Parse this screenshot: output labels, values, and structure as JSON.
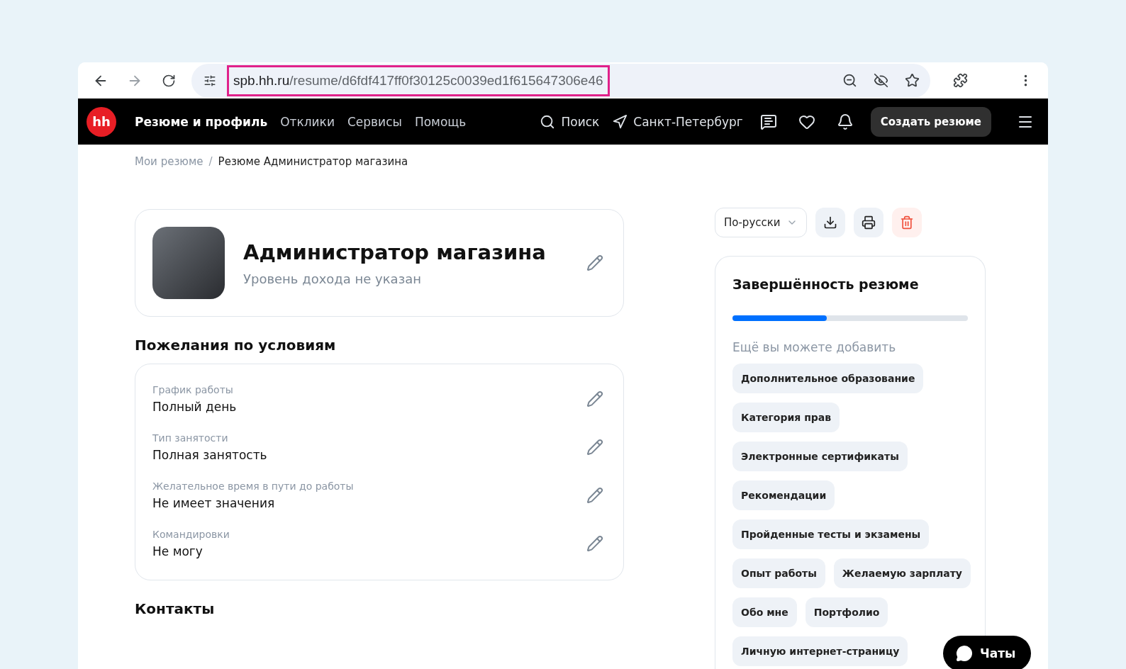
{
  "browser": {
    "url_host": "spb.hh.ru",
    "url_path": "/resume/d6fdf417ff0f30125c0039ed1f615647306e46"
  },
  "nav": {
    "logo": "hh",
    "items": [
      {
        "label": "Резюме и профиль",
        "selected": true
      },
      {
        "label": "Отклики",
        "selected": false
      },
      {
        "label": "Сервисы",
        "selected": false
      },
      {
        "label": "Помощь",
        "selected": false
      }
    ],
    "search": "Поиск",
    "city": "Санкт-Петербург",
    "create_button": "Создать резюме"
  },
  "breadcrumbs": [
    "Мои резюме",
    "Резюме Администратор магазина"
  ],
  "breadcrumb_separator": "/",
  "resume": {
    "title": "Администратор магазина",
    "salary": "Уровень дохода не указан"
  },
  "conditions": {
    "heading": "Пожелания по условиям",
    "fields": [
      {
        "label": "График работы",
        "value": "Полный день"
      },
      {
        "label": "Тип занятости",
        "value": "Полная занятость"
      },
      {
        "label": "Желательное время в пути до работы",
        "value": "Не имеет значения"
      },
      {
        "label": "Командировки",
        "value": "Не могу"
      }
    ]
  },
  "contacts_heading": "Контакты",
  "toolbar": {
    "language": "По-русски"
  },
  "completeness": {
    "title": "Завершённость резюме",
    "level": 0.4,
    "hint": "Ещё вы можете добавить",
    "chips": [
      [
        "Дополнительное образование"
      ],
      [
        "Категория прав"
      ],
      [
        "Электронные сертификаты"
      ],
      [
        "Рекомендации"
      ],
      [
        "Пройденные тесты и экзамены"
      ],
      [
        "Опыт работы",
        "Желаемую зарплату"
      ],
      [
        "Обо мне",
        "Портфолио"
      ],
      [
        "Личную интернет-страницу"
      ]
    ]
  },
  "chat_button": "Чаты"
}
